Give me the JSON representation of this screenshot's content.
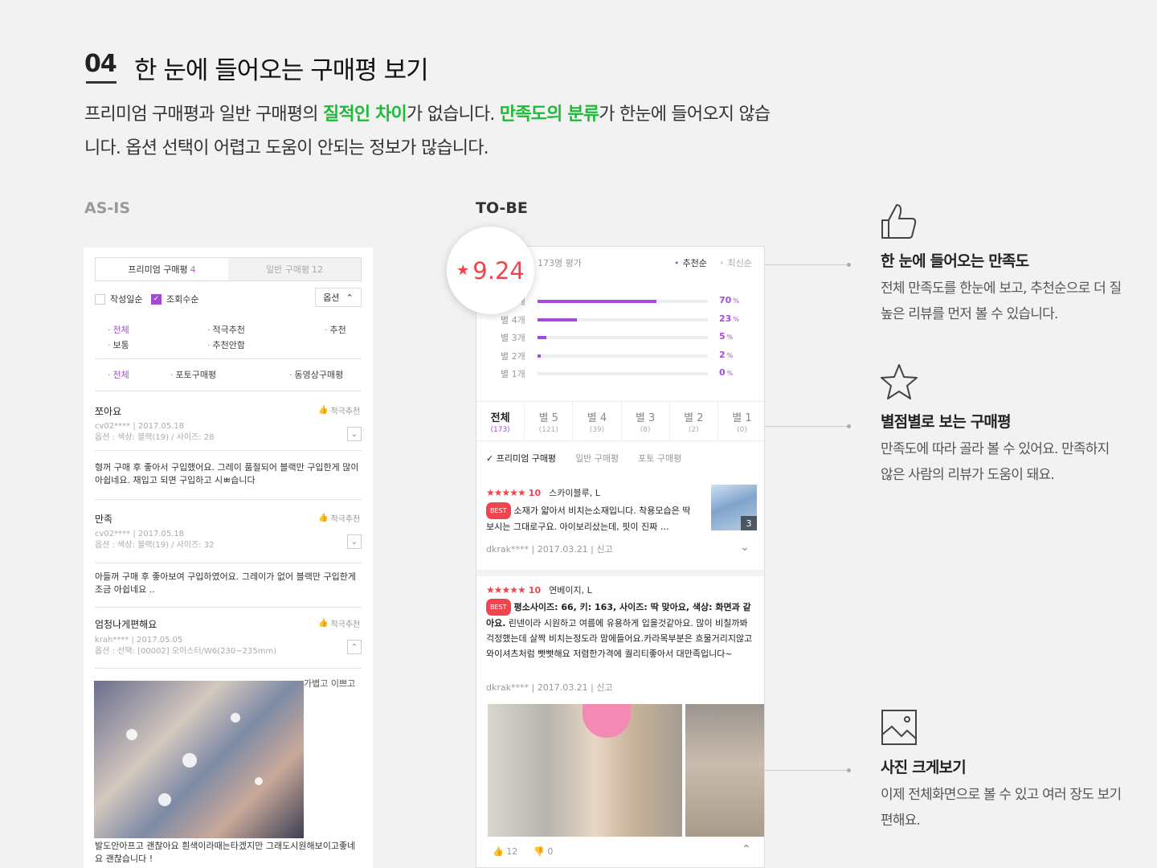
{
  "section": {
    "number": "04",
    "title": "한 눈에 들어오는 구매평 보기",
    "desc_parts": [
      {
        "text": "프리미엄 구매평과 일반 구매평의 ",
        "hl": false
      },
      {
        "text": "질적인 차이",
        "hl": true
      },
      {
        "text": "가 없습니다. ",
        "hl": false
      },
      {
        "text": "만족도의 분류",
        "hl": true
      },
      {
        "text": "가 한눈에 들어오지 않습니다. 옵션 선택이 어렵고 도움이 안되는 정보가 많습니다.",
        "hl": false
      }
    ],
    "highlight_color": "#1fba3a"
  },
  "labels": {
    "asis": "AS-IS",
    "tobe": "TO-BE"
  },
  "asis": {
    "tabs": [
      {
        "label": "프리미엄 구매평",
        "count": "4"
      },
      {
        "label": "일반 구매평",
        "count": "12"
      }
    ],
    "checks": [
      {
        "label": "작성일순",
        "checked": false
      },
      {
        "label": "조회수순",
        "checked": true
      }
    ],
    "option_button": "옵션",
    "filters_row1": [
      "전체",
      "적극추천",
      "추천"
    ],
    "filters_row2": [
      "보통",
      "추천안함"
    ],
    "filters_row3": [
      "전체",
      "포토구매평",
      "동영상구매평"
    ],
    "recommend_label": "적극추천",
    "reviews": [
      {
        "title": "쪼아요",
        "user": "cv02****",
        "date": "2017.05.18",
        "option": "옵션 : 색상: 블랙(19) / 사이즈: 28",
        "body": "형꺼 구매 후 좋아서 구입했어요. 그레이 품절되어 블랙만 구입한게 많이 아쉽네요. 재입고 되면 구입하고 시ㅃ습니다"
      },
      {
        "title": "만족",
        "user": "cv02****",
        "date": "2017.05.18",
        "option": "옵션 : 색상: 블랙(19) / 사이즈: 32",
        "body": "아들꺼 구매 후 좋아보여 구입하였어요. 그레이가 없어 블랙만 구입한게 조금 아쉽네요 .."
      },
      {
        "title": "엄청나게편해요",
        "user": "krah****",
        "date": "2017.05.05",
        "option": "옵션 : 선택: [00002] 오이스터/W6(230~235mm)",
        "body": ""
      }
    ],
    "photo_caption": "가볍고 이쁘고",
    "photo_body": "발도안아프고 괜찮아요 흰색이라때는타겠지만 그래도시원해보이고좋네요 괜찮습니다 !"
  },
  "tobe": {
    "rating": "9.24",
    "count_text": "173명 평가",
    "sort": [
      "추천순",
      "최신순"
    ],
    "bars": [
      {
        "label": "별 5개",
        "pct": 70
      },
      {
        "label": "별 4개",
        "pct": 23
      },
      {
        "label": "별 3개",
        "pct": 5
      },
      {
        "label": "별 2개",
        "pct": 2
      },
      {
        "label": "별 1개",
        "pct": 0
      }
    ],
    "star_tabs": [
      {
        "name": "전체",
        "count": "(173)"
      },
      {
        "name": "별 5",
        "count": "(121)"
      },
      {
        "name": "별 4",
        "count": "(39)"
      },
      {
        "name": "별 3",
        "count": "(8)"
      },
      {
        "name": "별 2",
        "count": "(2)"
      },
      {
        "name": "별 1",
        "count": "(0)"
      }
    ],
    "type_tabs": [
      "프리미엄 구매평",
      "일반 구매평",
      "포토 구매평"
    ],
    "reviews": [
      {
        "score": "10",
        "option": "스카이블루, L",
        "badge": "BEST",
        "text": "소재가 얇아서 비치는소재입니다. 착용모습은 딱 보시는 그대로구요. 아이보리샀는데, 핏이 진짜 …",
        "user": "dkrak****",
        "date": "2017.03.21",
        "report": "신고",
        "photo_count": "3"
      },
      {
        "score": "10",
        "option": "연베이지, L",
        "badge": "BEST",
        "text_bold": "평소사이즈: 66, 키: 163, 사이즈: 딱 맞아요, 색상: 화면과 같아요.",
        "text": " 린넨이라 시원하고 여름에 유용하게 입을것같아요. 많이 비칠까봐 걱정했는데 살짝 비치는정도라 맘에들어요.카라목부분은 흐물거리지않고 와이셔츠처럼 빳빳해요 저렴한가격에 퀄리티좋아서 대만족입니다~",
        "user": "dkrak****",
        "date": "2017.03.21",
        "report": "신고",
        "likes": "12",
        "dislikes": "0"
      }
    ],
    "accent": "#a64bdf",
    "star_color": "#f2434e"
  },
  "features": [
    {
      "icon": "thumbs-up-icon",
      "title": "한 눈에 들어오는 만족도",
      "desc": "전체 만족도를 한눈에 보고, 추천순으로 더 질 높은 리뷰를 먼저 볼 수 있습니다."
    },
    {
      "icon": "star-icon",
      "title": "별점별로 보는 구매평",
      "desc": "만족도에 따라 골라 볼 수 있어요. 만족하지 않은 사람의 리뷰가 도움이 돼요."
    },
    {
      "icon": "image-icon",
      "title": "사진 크게보기",
      "desc": "이제 전체화면으로 볼 수 있고 여러 장도 보기 편해요."
    }
  ]
}
